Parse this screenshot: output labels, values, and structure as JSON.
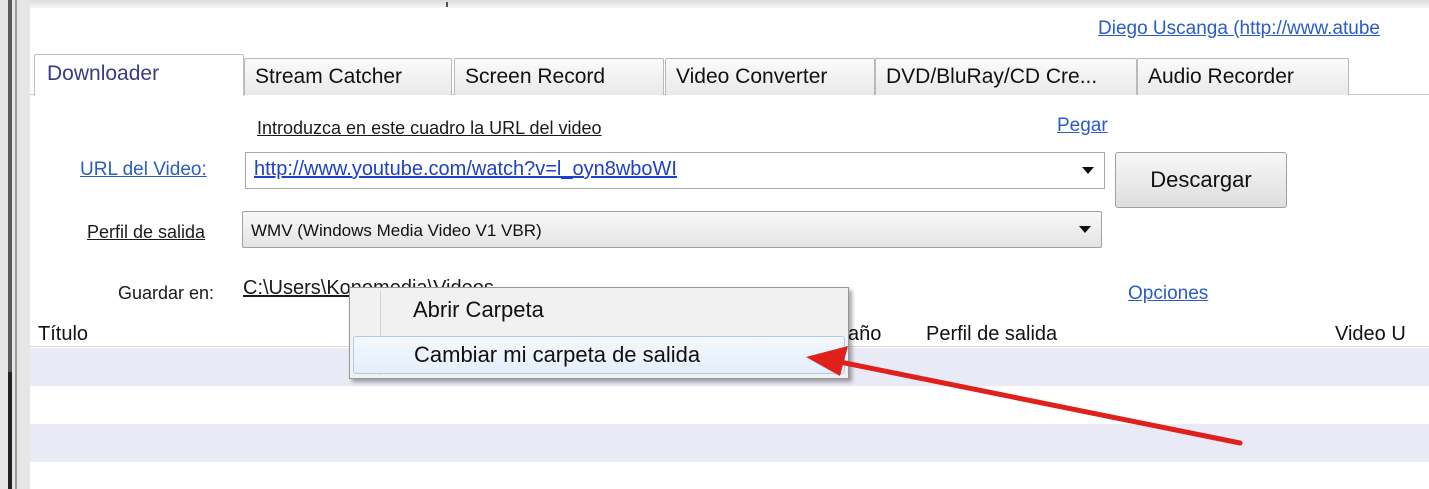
{
  "author_link": "Diego Uscanga (http://www.atube",
  "tabs": [
    {
      "label": "Downloader",
      "active": true
    },
    {
      "label": "Stream Catcher",
      "active": false
    },
    {
      "label": "Screen Record",
      "active": false
    },
    {
      "label": "Video Converter",
      "active": false
    },
    {
      "label": "DVD/BluRay/CD Cre...",
      "active": false
    },
    {
      "label": "Audio Recorder",
      "active": false
    }
  ],
  "downloader": {
    "hint": "Introduzca en este cuadro la URL del video",
    "paste_link": "Pegar",
    "url_label": "URL del Video:",
    "url_value": "http://www.youtube.com/watch?v=l_oyn8wboWI",
    "download_button": "Descargar",
    "profile_label": "Perfil de salida",
    "profile_value": "WMV (Windows Media Video V1 VBR)",
    "save_label": "Guardar en:",
    "save_path": "C:\\Users\\Konomedia\\Videos",
    "options_link": "Opciones"
  },
  "table": {
    "columns": [
      "Título",
      "año",
      "Perfil de salida",
      "Video U"
    ]
  },
  "context_menu": {
    "items": [
      {
        "label": "Abrir Carpeta",
        "highlighted": false
      },
      {
        "label": "Cambiar mi carpeta de salida",
        "highlighted": true
      }
    ]
  },
  "annotation": {
    "arrow_color": "#e0201b"
  }
}
